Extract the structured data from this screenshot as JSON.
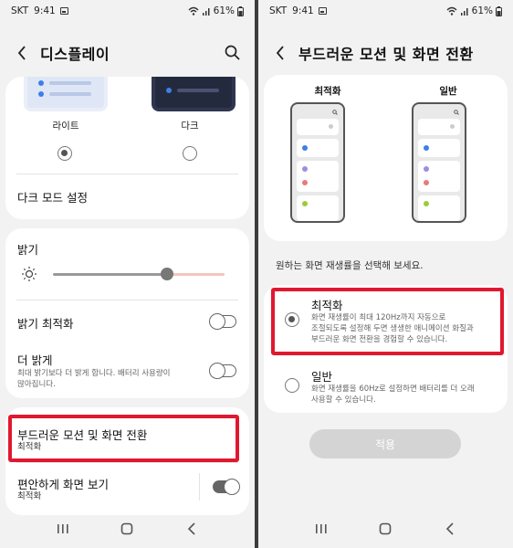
{
  "status": {
    "carrier": "SKT",
    "time": "9:41",
    "battery": "61%"
  },
  "left": {
    "title": "디스플레이",
    "theme": {
      "light_label": "라이트",
      "dark_label": "다크",
      "selected": "light"
    },
    "dark_mode_settings": "다크 모드 설정",
    "brightness": {
      "label": "밝기",
      "level": 0.74
    },
    "adaptive_brightness": {
      "label": "밝기 최적화",
      "on": false
    },
    "extra_brightness": {
      "label": "더 밝게",
      "desc_line1": "최대 밝기보다 더 밝게 합니다. 배터리 사용량이",
      "desc_line2": "많아집니다.",
      "on": false
    },
    "motion_smoothness": {
      "label": "부드러운 모션 및 화면 전환",
      "value": "최적화"
    },
    "eye_comfort": {
      "label": "편안하게 화면 보기",
      "value": "최적화",
      "on": true
    }
  },
  "right": {
    "title": "부드러운 모션 및 화면 전환",
    "preview_labels": {
      "optimized": "최적화",
      "standard": "일반"
    },
    "prompt": "원하는 화면 재생률을 선택해 보세요.",
    "options": [
      {
        "label": "최적화",
        "desc_line1": "화면 재생률이 최대 120Hz까지 자동으로",
        "desc_line2": "조절되도록 설정해 두면 생생한 애니메이션 화질과",
        "desc_line3": "부드러운 화면 전환을 경험할 수 있습니다.",
        "selected": true
      },
      {
        "label": "일반",
        "desc_line1": "화면 재생률을 60Hz로 설정하면 배터리를 더 오래",
        "desc_line2": "사용할 수 있습니다.",
        "selected": false
      }
    ],
    "apply_label": "적용"
  },
  "colors": {
    "highlight": "#e0182f",
    "accent_blue": "#3f7ee8",
    "apply_disabled": "#d4d4d4"
  },
  "icons": [
    "back-arrow-icon",
    "search-icon",
    "sun-icon",
    "recents-icon",
    "home-icon",
    "back-icon"
  ]
}
